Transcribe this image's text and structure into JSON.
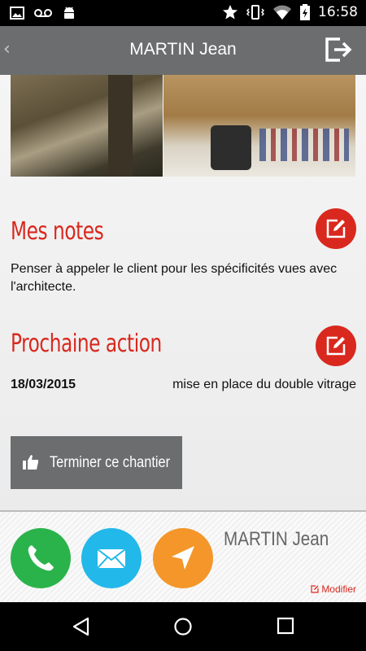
{
  "status_bar": {
    "time": "16:58",
    "icons": [
      "image-icon",
      "voicemail-icon",
      "android-icon",
      "star-icon",
      "vibrate-icon",
      "wifi-icon",
      "battery-charging-icon"
    ]
  },
  "app_bar": {
    "back_icon": "chevron-left-icon",
    "title": "MARTIN Jean",
    "logout_icon": "logout-icon"
  },
  "notes": {
    "title": "Mes notes",
    "text": "Penser à appeler le client pour les spécificités vues avec l'architecte.",
    "edit_icon": "edit-icon"
  },
  "next_action": {
    "title": "Prochaine action",
    "date": "18/03/2015",
    "description": "mise en place du double vitrage",
    "edit_icon": "edit-icon"
  },
  "finish_button": {
    "label": "Terminer ce chantier",
    "icon": "thumbs-up-icon"
  },
  "contact": {
    "name": "MARTIN Jean",
    "modify_label": "Modifier",
    "actions": [
      {
        "icon": "phone-icon",
        "color": "#2bb34b"
      },
      {
        "icon": "mail-icon",
        "color": "#22b8ea"
      },
      {
        "icon": "navigation-icon",
        "color": "#f4962a"
      }
    ]
  },
  "colors": {
    "accent": "#d9281e",
    "toolbar": "#6b6d6e"
  }
}
